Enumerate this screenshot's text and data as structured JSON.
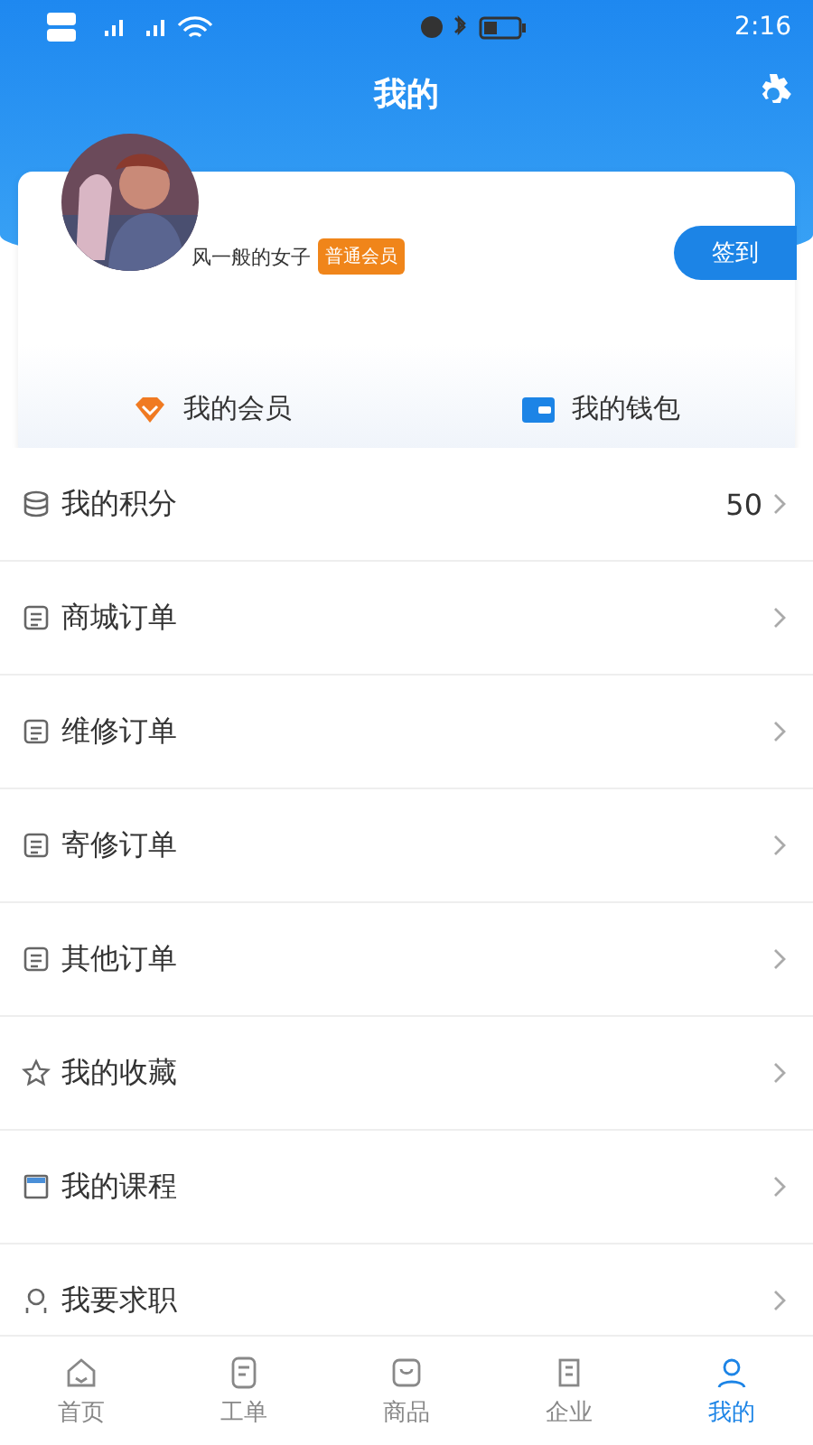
{
  "status_bar": {
    "time": "2:16"
  },
  "header": {
    "title": "我的"
  },
  "profile": {
    "name": "风一般的女子",
    "badge": "普通会员",
    "sign_in": "签到"
  },
  "shortcuts": [
    {
      "kind": "member",
      "label": "我的会员"
    },
    {
      "kind": "wallet",
      "label": "我的钱包"
    }
  ],
  "menu": [
    {
      "kind": "points",
      "label": "我的积分",
      "value": "50"
    },
    {
      "kind": "order",
      "label": "商城订单"
    },
    {
      "kind": "order",
      "label": "维修订单"
    },
    {
      "kind": "order",
      "label": "寄修订单"
    },
    {
      "kind": "order",
      "label": "其他订单"
    },
    {
      "kind": "star",
      "label": "我的收藏"
    },
    {
      "kind": "course",
      "label": "我的课程"
    },
    {
      "kind": "job",
      "label": "我要求职"
    }
  ],
  "tabs": [
    {
      "kind": "home",
      "label": "首页",
      "selected": false
    },
    {
      "kind": "ticket",
      "label": "工单",
      "selected": false
    },
    {
      "kind": "goods",
      "label": "商品",
      "selected": false
    },
    {
      "kind": "company",
      "label": "企业",
      "selected": false
    },
    {
      "kind": "me",
      "label": "我的",
      "selected": true
    }
  ]
}
